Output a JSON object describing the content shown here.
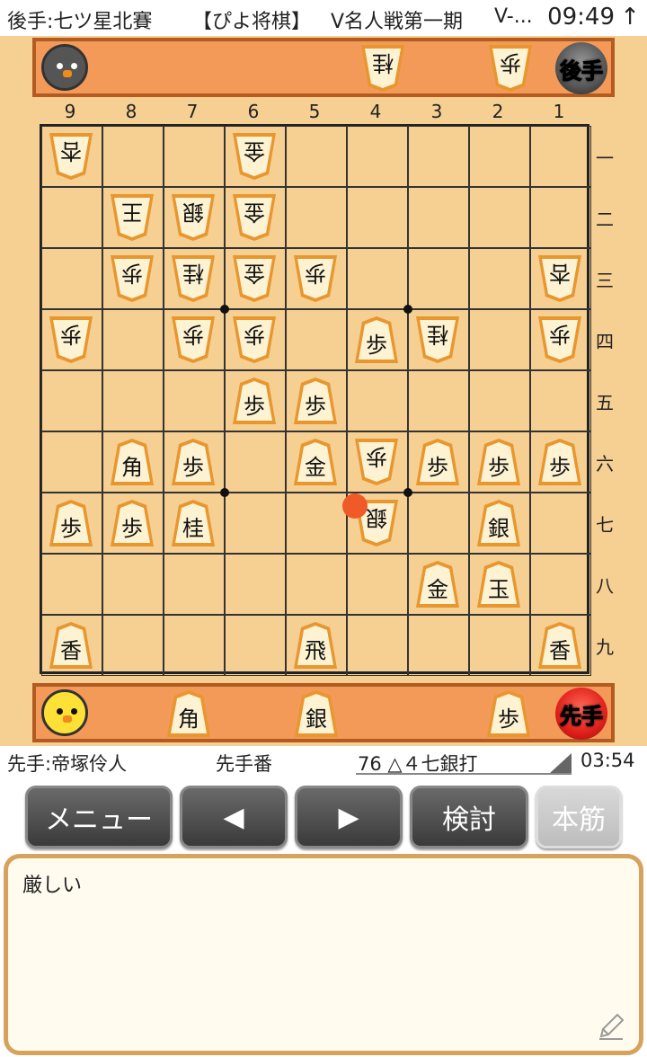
{
  "statusbar": {
    "gote_player": "後手:七ツ星北賽",
    "app_title": "【ぴよ将棋】",
    "event": "V名人戦第一期",
    "event_more": "V-...",
    "clock": "09:49",
    "arrow": "↑"
  },
  "hands": {
    "gote": [
      "桂",
      "歩"
    ],
    "gote_label": "後手",
    "sente": [
      "角",
      "銀",
      "歩"
    ],
    "sente_label": "先手"
  },
  "coords": {
    "files": [
      "9",
      "8",
      "7",
      "6",
      "5",
      "4",
      "3",
      "2",
      "1"
    ],
    "ranks": [
      "一",
      "二",
      "三",
      "四",
      "五",
      "六",
      "七",
      "八",
      "九"
    ]
  },
  "board": [
    {
      "file": 9,
      "rank": 1,
      "piece": "杏",
      "owner": "gote"
    },
    {
      "file": 6,
      "rank": 1,
      "piece": "金",
      "owner": "gote"
    },
    {
      "file": 8,
      "rank": 2,
      "piece": "王",
      "owner": "gote"
    },
    {
      "file": 7,
      "rank": 2,
      "piece": "銀",
      "owner": "gote"
    },
    {
      "file": 6,
      "rank": 2,
      "piece": "金",
      "owner": "gote"
    },
    {
      "file": 8,
      "rank": 3,
      "piece": "歩",
      "owner": "gote"
    },
    {
      "file": 7,
      "rank": 3,
      "piece": "桂",
      "owner": "gote"
    },
    {
      "file": 6,
      "rank": 3,
      "piece": "金",
      "owner": "gote"
    },
    {
      "file": 5,
      "rank": 3,
      "piece": "歩",
      "owner": "gote"
    },
    {
      "file": 1,
      "rank": 3,
      "piece": "杏",
      "owner": "gote"
    },
    {
      "file": 9,
      "rank": 4,
      "piece": "歩",
      "owner": "gote"
    },
    {
      "file": 7,
      "rank": 4,
      "piece": "歩",
      "owner": "gote"
    },
    {
      "file": 6,
      "rank": 4,
      "piece": "歩",
      "owner": "gote"
    },
    {
      "file": 4,
      "rank": 4,
      "piece": "歩",
      "owner": "sente"
    },
    {
      "file": 3,
      "rank": 4,
      "piece": "桂",
      "owner": "gote"
    },
    {
      "file": 1,
      "rank": 4,
      "piece": "歩",
      "owner": "gote"
    },
    {
      "file": 6,
      "rank": 5,
      "piece": "歩",
      "owner": "sente"
    },
    {
      "file": 5,
      "rank": 5,
      "piece": "歩",
      "owner": "sente"
    },
    {
      "file": 8,
      "rank": 6,
      "piece": "角",
      "owner": "sente"
    },
    {
      "file": 7,
      "rank": 6,
      "piece": "歩",
      "owner": "sente"
    },
    {
      "file": 5,
      "rank": 6,
      "piece": "金",
      "owner": "sente"
    },
    {
      "file": 4,
      "rank": 6,
      "piece": "歩",
      "owner": "gote"
    },
    {
      "file": 3,
      "rank": 6,
      "piece": "歩",
      "owner": "sente"
    },
    {
      "file": 2,
      "rank": 6,
      "piece": "歩",
      "owner": "sente"
    },
    {
      "file": 1,
      "rank": 6,
      "piece": "歩",
      "owner": "sente"
    },
    {
      "file": 9,
      "rank": 7,
      "piece": "歩",
      "owner": "sente"
    },
    {
      "file": 8,
      "rank": 7,
      "piece": "歩",
      "owner": "sente"
    },
    {
      "file": 7,
      "rank": 7,
      "piece": "桂",
      "owner": "sente"
    },
    {
      "file": 4,
      "rank": 7,
      "piece": "銀",
      "owner": "gote",
      "last_move": true
    },
    {
      "file": 2,
      "rank": 7,
      "piece": "銀",
      "owner": "sente"
    },
    {
      "file": 3,
      "rank": 8,
      "piece": "金",
      "owner": "sente"
    },
    {
      "file": 2,
      "rank": 8,
      "piece": "玉",
      "owner": "sente"
    },
    {
      "file": 9,
      "rank": 9,
      "piece": "香",
      "owner": "sente"
    },
    {
      "file": 5,
      "rank": 9,
      "piece": "飛",
      "owner": "sente"
    },
    {
      "file": 1,
      "rank": 9,
      "piece": "香",
      "owner": "sente"
    }
  ],
  "info": {
    "sente_player": "先手:帝塚伶人",
    "turn": "先手番",
    "move": "76 △４七銀打",
    "time": "03:54"
  },
  "buttons": {
    "menu": "メニュー",
    "prev": "◀",
    "next": "▶",
    "review": "検討",
    "mainline": "本筋"
  },
  "comment": {
    "text": "厳しい"
  },
  "colors": {
    "board": "#f6cf93",
    "hand": "#f39a58",
    "piece_face": "#fdf2d2",
    "piece_edge": "#e8962e",
    "last_move": "#f05a28"
  }
}
